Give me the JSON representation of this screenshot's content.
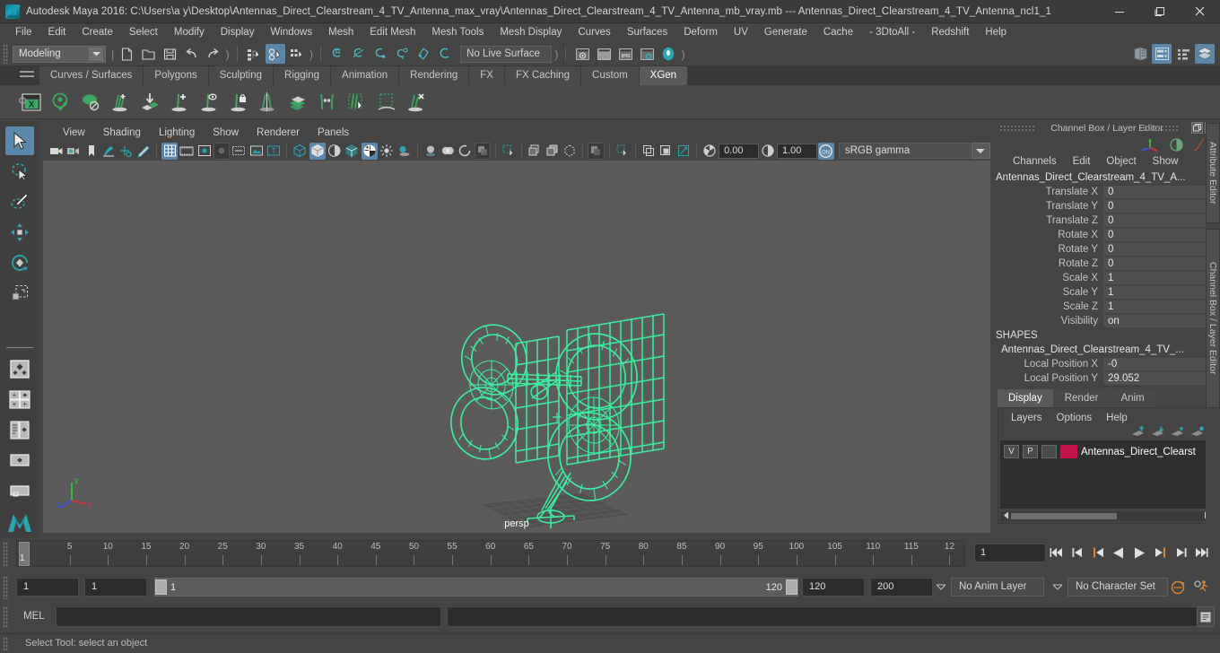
{
  "window": {
    "title": "Autodesk Maya 2016: C:\\Users\\a y\\Desktop\\Antennas_Direct_Clearstream_4_TV_Antenna_max_vray\\Antennas_Direct_Clearstream_4_TV_Antenna_mb_vray.mb  ---  Antennas_Direct_Clearstream_4_TV_Antenna_ncl1_1",
    "minimize": "–",
    "maximize": "❐",
    "close": "✕"
  },
  "menubar": {
    "items": [
      "File",
      "Edit",
      "Create",
      "Select",
      "Modify",
      "Display",
      "Windows",
      "Mesh",
      "Edit Mesh",
      "Mesh Tools",
      "Mesh Display",
      "Curves",
      "Surfaces",
      "Deform",
      "UV",
      "Generate",
      "Cache",
      "- 3DtoAll -",
      "Redshift",
      "Help"
    ]
  },
  "statusline": {
    "mode": "Modeling",
    "live_surface": "No Live Surface",
    "icons": [
      "new-scene-icon",
      "open-scene-icon",
      "save-scene-icon",
      "undo-icon",
      "redo-icon",
      "select-by-hierarchy-icon",
      "select-by-object-icon",
      "select-by-component-icon",
      "snap-to-grid-icon",
      "snap-to-curve-icon",
      "snap-to-point-icon",
      "snap-to-projected-center-icon",
      "snap-to-view-plane-icon",
      "make-live-icon",
      "render-current-frame-icon",
      "render-sequence-icon",
      "ipr-render-icon",
      "render-settings-icon",
      "hypershade-icon"
    ],
    "right_icons": [
      "show-hide-editors-icon",
      "attribute-editor-icon",
      "tool-settings-icon",
      "channel-box-icon"
    ]
  },
  "shelf": {
    "tabs": [
      "Curves / Surfaces",
      "Polygons",
      "Sculpting",
      "Rigging",
      "Animation",
      "Rendering",
      "FX",
      "FX Caching",
      "Custom",
      "XGen"
    ],
    "active_tab": "XGen",
    "icons": [
      "xgen-window-icon",
      "xgen-preview-icon",
      "xgen-disable-preview-icon",
      "xgen-add-groom-icon",
      "xgen-convert-to-interactive-icon",
      "xgen-add-guide-icon",
      "xgen-preview-guide-icon",
      "xgen-freeze-guide-icon",
      "xgen-mirror-guide-icon",
      "xgen-density-icon",
      "xgen-length-icon",
      "xgen-select-guides-icon",
      "xgen-region-icon",
      "xgen-delete-guide-icon"
    ]
  },
  "toolbox": {
    "tools": [
      "select-tool",
      "lasso-select-tool",
      "paint-select-tool",
      "move-tool",
      "rotate-tool",
      "scale-tool",
      "last-tool-used",
      "four-view-layout",
      "persp-outliner-layout",
      "persp-graph-layout",
      "single-persp-layout",
      "hypershade-persp-layout",
      "maya-logo"
    ],
    "selected": "select-tool"
  },
  "viewport": {
    "menus": [
      "View",
      "Shading",
      "Lighting",
      "Show",
      "Renderer",
      "Panels"
    ],
    "camera_label": "persp",
    "exposure": "0.00",
    "gamma_value": "1.00",
    "color_management": "sRGB gamma",
    "gate_toggle": "ON",
    "background_color": "#5b5b5b",
    "wireframe_color": "#3cf0a0",
    "toolbar_icons": [
      "select-camera-icon",
      "camera-attributes-icon",
      "bookmark-icon",
      "image-plane-icon",
      "2d-pan-zoom-icon",
      "grease-pencil-icon",
      "grid-icon",
      "film-gate-icon",
      "resolution-gate-icon",
      "gate-mask-icon",
      "xray-joints-icon",
      "image-plane-display-icon",
      "texture-placement-icon",
      "wireframe-icon",
      "smooth-shade-all-icon",
      "smooth-shade-flat-icon",
      "wireframe-on-shaded-icon",
      "textured-icon",
      "use-all-lights-icon",
      "shadows-icon",
      "screen-space-ao-icon",
      "motion-blur-icon",
      "multisample-aa-icon",
      "depth-of-field-icon",
      "isolate-select-icon",
      "xray-icon",
      "xray-active-icon",
      "xray-component-icon",
      "exposure-icon",
      "gamma-icon"
    ]
  },
  "channelbox": {
    "panel_title": "Channel Box / Layer Editor",
    "menus": [
      "Channels",
      "Edit",
      "Object",
      "Show"
    ],
    "object_name": "Antennas_Direct_Clearstream_4_TV_A...",
    "transform_rows": [
      {
        "attr": "Translate X",
        "value": "0"
      },
      {
        "attr": "Translate Y",
        "value": "0"
      },
      {
        "attr": "Translate Z",
        "value": "0"
      },
      {
        "attr": "Rotate X",
        "value": "0"
      },
      {
        "attr": "Rotate Y",
        "value": "0"
      },
      {
        "attr": "Rotate Z",
        "value": "0"
      },
      {
        "attr": "Scale X",
        "value": "1"
      },
      {
        "attr": "Scale Y",
        "value": "1"
      },
      {
        "attr": "Scale Z",
        "value": "1"
      },
      {
        "attr": "Visibility",
        "value": "on"
      }
    ],
    "shapes_header": "SHAPES",
    "shape_name": "Antennas_Direct_Clearstream_4_TV_...",
    "shape_rows": [
      {
        "attr": "Local Position X",
        "value": "-0"
      },
      {
        "attr": "Local Position Y",
        "value": "29.052"
      }
    ]
  },
  "layer_editor": {
    "tabs": [
      "Display",
      "Render",
      "Anim"
    ],
    "active_tab": "Display",
    "menus": [
      "Layers",
      "Options",
      "Help"
    ],
    "icons": [
      "move-layer-up-icon",
      "move-layer-down-icon",
      "new-layer-icon",
      "new-layer-from-selected-icon"
    ],
    "layers": [
      {
        "visibility": "V",
        "playback": "P",
        "shading": "",
        "color": "#c4134a",
        "name": "Antennas_Direct_Clearst"
      }
    ]
  },
  "dock_tabs": [
    "Attribute Editor",
    "Channel Box / Layer Editor"
  ],
  "timeline": {
    "tick_labels": [
      "5",
      "10",
      "15",
      "20",
      "25",
      "30",
      "35",
      "40",
      "45",
      "50",
      "55",
      "60",
      "65",
      "70",
      "75",
      "80",
      "85",
      "90",
      "95",
      "100",
      "105",
      "110",
      "115",
      "12"
    ],
    "current_frame_marker": "1",
    "current_frame_field": "1",
    "playback_buttons": [
      "go-to-start-icon",
      "step-back-keyframe-icon",
      "step-back-frame-icon",
      "play-backwards-icon",
      "play-forwards-icon",
      "step-forward-frame-icon",
      "step-forward-keyframe-icon",
      "go-to-end-icon"
    ]
  },
  "range": {
    "anim_start": "1",
    "range_start": "1",
    "bar_start": "1",
    "bar_end": "120",
    "range_end": "120",
    "anim_end": "200",
    "anim_layer": "No Anim Layer",
    "character_set": "No Character Set",
    "auto_key_icon": "auto-keyframe-icon",
    "anim_prefs_icon": "animation-preferences-icon"
  },
  "command_line": {
    "language": "MEL",
    "input_value": "",
    "output_value": "",
    "script_editor_icon": "script-editor-icon"
  },
  "statusbar": {
    "message": "Select Tool: select an object"
  },
  "colors": {
    "accent_blue": "#5d87a8",
    "wireframe_green": "#3cf0a0",
    "layer_red": "#c4134a",
    "panel_bg": "#444444",
    "viewport_bg": "#5b5b5b",
    "teal_icon": "#2ba5b0",
    "orange": "#e08a2e"
  }
}
